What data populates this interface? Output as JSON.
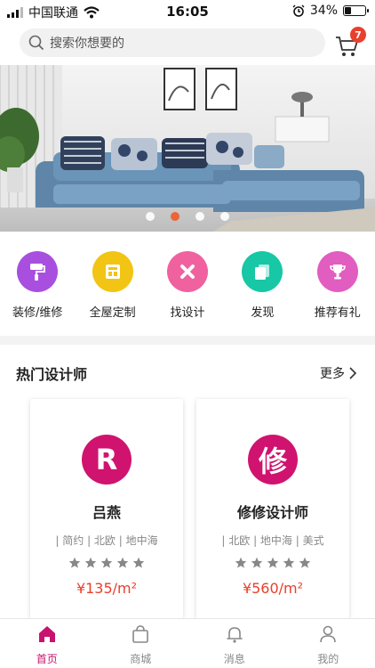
{
  "status_bar": {
    "carrier": "中国联通",
    "time": "16:05",
    "battery_text": "34%",
    "battery_level": 0.34
  },
  "search": {
    "placeholder": "搜索你想要的"
  },
  "cart": {
    "badge": "7"
  },
  "banner": {
    "slide_count": 4,
    "active_index": 1
  },
  "categories": [
    {
      "label": "装修/维修",
      "icon": "paint-roller-icon",
      "color": "#a84fe0"
    },
    {
      "label": "全屋定制",
      "icon": "layout-icon",
      "color": "#f2c414"
    },
    {
      "label": "找设计",
      "icon": "design-close-icon",
      "color": "#f061a0"
    },
    {
      "label": "发现",
      "icon": "stack-icon",
      "color": "#17c7a6"
    },
    {
      "label": "推荐有礼",
      "icon": "trophy-icon",
      "color": "#e15dc0"
    }
  ],
  "section": {
    "title": "热门设计师",
    "more": "更多"
  },
  "designers": [
    {
      "name": "吕燕",
      "logo_text": "R",
      "tags": "| 简约 | 北欧 | 地中海",
      "stars": 5,
      "price": "¥135/m²"
    },
    {
      "name": "修修设计师",
      "logo_text": "修",
      "tags": "| 北欧 | 地中海 | 美式",
      "stars": 5,
      "price": "¥560/m²"
    }
  ],
  "tabbar": [
    {
      "label": "首页",
      "icon": "home-icon",
      "active": true
    },
    {
      "label": "商城",
      "icon": "shopping-bag-icon",
      "active": false
    },
    {
      "label": "消息",
      "icon": "bell-icon",
      "active": false
    },
    {
      "label": "我的",
      "icon": "user-icon",
      "active": false
    }
  ],
  "colors": {
    "accent": "#c8126e",
    "price": "#e8402c",
    "banner_active_dot": "#f05a28"
  }
}
